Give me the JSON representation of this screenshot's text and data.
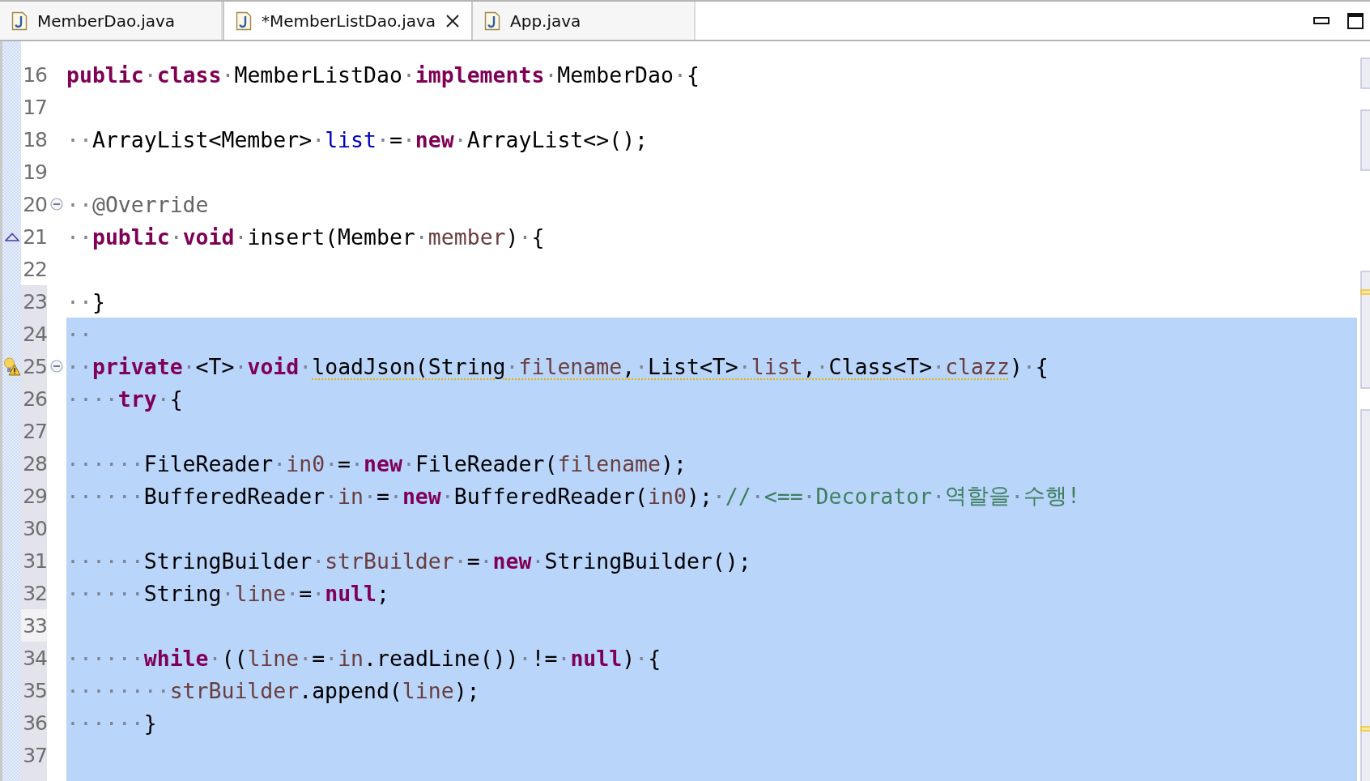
{
  "tabs": [
    {
      "label": "MemberDao.java",
      "selected": false,
      "close_button": false
    },
    {
      "label": "*MemberListDao.java",
      "selected": true,
      "close_button": true
    },
    {
      "label": "App.java",
      "selected": false,
      "close_button": false
    }
  ],
  "lines": [
    {
      "number": "16",
      "selected": false,
      "in_selection": false,
      "current": false,
      "fold": false,
      "tokens": [
        {
          "kind": "kw",
          "s": "public"
        },
        {
          "kind": "ws",
          "s": "·"
        },
        {
          "kind": "kw",
          "s": "class"
        },
        {
          "kind": "ws",
          "s": "·"
        },
        {
          "kind": "plain",
          "s": "MemberListDao"
        },
        {
          "kind": "ws",
          "s": "·"
        },
        {
          "kind": "kw",
          "s": "implements"
        },
        {
          "kind": "ws",
          "s": "·"
        },
        {
          "kind": "plain",
          "s": "MemberDao"
        },
        {
          "kind": "ws",
          "s": "·"
        },
        {
          "kind": "plain",
          "s": "{"
        }
      ]
    },
    {
      "number": "17",
      "selected": false,
      "in_selection": false,
      "current": false,
      "fold": false
    },
    {
      "number": "18",
      "selected": false,
      "in_selection": false,
      "current": false,
      "fold": false,
      "tokens": [
        {
          "kind": "ws",
          "s": "··"
        },
        {
          "kind": "plain",
          "s": "ArrayList<Member>"
        },
        {
          "kind": "ws",
          "s": "·"
        },
        {
          "kind": "field",
          "s": "list"
        },
        {
          "kind": "ws",
          "s": "·"
        },
        {
          "kind": "plain",
          "s": "="
        },
        {
          "kind": "ws",
          "s": "·"
        },
        {
          "kind": "kw",
          "s": "new"
        },
        {
          "kind": "ws",
          "s": "·"
        },
        {
          "kind": "plain",
          "s": "ArrayList<>();"
        }
      ]
    },
    {
      "number": "19",
      "selected": false,
      "in_selection": false,
      "current": false,
      "fold": false
    },
    {
      "number": "20",
      "selected": false,
      "in_selection": false,
      "current": false,
      "fold": true,
      "tokens": [
        {
          "kind": "ws",
          "s": "··"
        },
        {
          "kind": "ann",
          "s": "@Override"
        }
      ]
    },
    {
      "number": "21",
      "selected": false,
      "in_selection": false,
      "current": false,
      "fold": false,
      "marker": {
        "kind": "override"
      },
      "tokens": [
        {
          "kind": "ws",
          "s": "··"
        },
        {
          "kind": "kw",
          "s": "public"
        },
        {
          "kind": "ws",
          "s": "·"
        },
        {
          "kind": "kw",
          "s": "void"
        },
        {
          "kind": "ws",
          "s": "·"
        },
        {
          "kind": "plain",
          "s": "insert(Member"
        },
        {
          "kind": "ws",
          "s": "·"
        },
        {
          "kind": "var",
          "s": "member"
        },
        {
          "kind": "plain",
          "s": ")"
        },
        {
          "kind": "ws",
          "s": "·"
        },
        {
          "kind": "plain",
          "s": "{"
        }
      ]
    },
    {
      "number": "22",
      "selected": false,
      "in_selection": false,
      "current": false,
      "fold": false
    },
    {
      "number": "23",
      "selected": false,
      "in_selection": true,
      "current": false,
      "fold": false,
      "tokens": [
        {
          "kind": "ws",
          "s": "··"
        },
        {
          "kind": "plain",
          "s": "}"
        }
      ]
    },
    {
      "number": "24",
      "selected": true,
      "in_selection": true,
      "current": false,
      "fold": false,
      "tokens": [
        {
          "kind": "ws",
          "s": "··"
        }
      ]
    },
    {
      "number": "25",
      "selected": true,
      "in_selection": true,
      "current": false,
      "fold": true,
      "marker": {
        "kind": "warning"
      },
      "tokens": [
        {
          "kind": "ws",
          "s": "··"
        },
        {
          "kind": "kw",
          "s": "private"
        },
        {
          "kind": "ws",
          "s": "·"
        },
        {
          "kind": "plain",
          "s": "<T>"
        },
        {
          "kind": "ws",
          "s": "·"
        },
        {
          "kind": "kw",
          "s": "void"
        },
        {
          "kind": "ws",
          "s": "·"
        },
        {
          "kind": "warning",
          "tokens": [
            {
              "kind": "plain",
              "s": "loadJson(String"
            },
            {
              "kind": "ws",
              "s": "·"
            },
            {
              "kind": "var",
              "s": "filename"
            },
            {
              "kind": "plain",
              "s": ","
            },
            {
              "kind": "ws",
              "s": "·"
            },
            {
              "kind": "plain",
              "s": "List<T>"
            },
            {
              "kind": "ws",
              "s": "·"
            },
            {
              "kind": "var",
              "s": "list"
            },
            {
              "kind": "plain",
              "s": ","
            },
            {
              "kind": "ws",
              "s": "·"
            },
            {
              "kind": "plain",
              "s": "Class<T>"
            },
            {
              "kind": "ws",
              "s": "·"
            },
            {
              "kind": "var",
              "s": "clazz"
            }
          ]
        },
        {
          "kind": "plain",
          "s": ")"
        },
        {
          "kind": "ws",
          "s": "·"
        },
        {
          "kind": "plain",
          "s": "{"
        }
      ]
    },
    {
      "number": "26",
      "selected": true,
      "in_selection": true,
      "current": false,
      "fold": false,
      "tokens": [
        {
          "kind": "ws",
          "s": "····"
        },
        {
          "kind": "kw",
          "s": "try"
        },
        {
          "kind": "ws",
          "s": "·"
        },
        {
          "kind": "plain",
          "s": "{"
        }
      ]
    },
    {
      "number": "27",
      "selected": true,
      "in_selection": true,
      "current": false,
      "fold": false
    },
    {
      "number": "28",
      "selected": true,
      "in_selection": true,
      "current": false,
      "fold": false,
      "tokens": [
        {
          "kind": "ws",
          "s": "······"
        },
        {
          "kind": "plain",
          "s": "FileReader"
        },
        {
          "kind": "ws",
          "s": "·"
        },
        {
          "kind": "var",
          "s": "in0"
        },
        {
          "kind": "ws",
          "s": "·"
        },
        {
          "kind": "plain",
          "s": "="
        },
        {
          "kind": "ws",
          "s": "·"
        },
        {
          "kind": "kw",
          "s": "new"
        },
        {
          "kind": "ws",
          "s": "·"
        },
        {
          "kind": "plain",
          "s": "FileReader("
        },
        {
          "kind": "var",
          "s": "filename"
        },
        {
          "kind": "plain",
          "s": ");"
        }
      ]
    },
    {
      "number": "29",
      "selected": true,
      "in_selection": true,
      "current": false,
      "fold": false,
      "tokens": [
        {
          "kind": "ws",
          "s": "······"
        },
        {
          "kind": "plain",
          "s": "BufferedReader"
        },
        {
          "kind": "ws",
          "s": "·"
        },
        {
          "kind": "var",
          "s": "in"
        },
        {
          "kind": "ws",
          "s": "·"
        },
        {
          "kind": "plain",
          "s": "="
        },
        {
          "kind": "ws",
          "s": "·"
        },
        {
          "kind": "kw",
          "s": "new"
        },
        {
          "kind": "ws",
          "s": "·"
        },
        {
          "kind": "plain",
          "s": "BufferedReader("
        },
        {
          "kind": "var",
          "s": "in0"
        },
        {
          "kind": "plain",
          "s": ");"
        },
        {
          "kind": "ws",
          "s": "·"
        },
        {
          "kind": "comment",
          "s": "//"
        },
        {
          "kind": "ws",
          "s": "·"
        },
        {
          "kind": "comment",
          "s": "<=="
        },
        {
          "kind": "ws",
          "s": "·"
        },
        {
          "kind": "comment",
          "s": "Decorator"
        },
        {
          "kind": "ws",
          "s": "·"
        },
        {
          "kind": "comment",
          "s": "역할을"
        },
        {
          "kind": "ws",
          "s": "·"
        },
        {
          "kind": "comment",
          "s": "수행!"
        }
      ]
    },
    {
      "number": "30",
      "selected": true,
      "in_selection": true,
      "current": false,
      "fold": false
    },
    {
      "number": "31",
      "selected": true,
      "in_selection": true,
      "current": false,
      "fold": false,
      "tokens": [
        {
          "kind": "ws",
          "s": "······"
        },
        {
          "kind": "plain",
          "s": "StringBuilder"
        },
        {
          "kind": "ws",
          "s": "·"
        },
        {
          "kind": "var",
          "s": "strBuilder"
        },
        {
          "kind": "ws",
          "s": "·"
        },
        {
          "kind": "plain",
          "s": "="
        },
        {
          "kind": "ws",
          "s": "·"
        },
        {
          "kind": "kw",
          "s": "new"
        },
        {
          "kind": "ws",
          "s": "·"
        },
        {
          "kind": "plain",
          "s": "StringBuilder();"
        }
      ]
    },
    {
      "number": "32",
      "selected": true,
      "in_selection": true,
      "current": false,
      "fold": false,
      "tokens": [
        {
          "kind": "ws",
          "s": "······"
        },
        {
          "kind": "plain",
          "s": "String"
        },
        {
          "kind": "ws",
          "s": "·"
        },
        {
          "kind": "var",
          "s": "line"
        },
        {
          "kind": "ws",
          "s": "·"
        },
        {
          "kind": "plain",
          "s": "="
        },
        {
          "kind": "ws",
          "s": "·"
        },
        {
          "kind": "kw",
          "s": "null"
        },
        {
          "kind": "plain",
          "s": ";"
        }
      ]
    },
    {
      "number": "33",
      "selected": true,
      "in_selection": true,
      "current": true,
      "fold": false
    },
    {
      "number": "34",
      "selected": true,
      "in_selection": true,
      "current": false,
      "fold": false,
      "tokens": [
        {
          "kind": "ws",
          "s": "······"
        },
        {
          "kind": "kw",
          "s": "while"
        },
        {
          "kind": "ws",
          "s": "·"
        },
        {
          "kind": "plain",
          "s": "(("
        },
        {
          "kind": "var",
          "s": "line"
        },
        {
          "kind": "ws",
          "s": "·"
        },
        {
          "kind": "plain",
          "s": "="
        },
        {
          "kind": "ws",
          "s": "·"
        },
        {
          "kind": "var",
          "s": "in"
        },
        {
          "kind": "plain",
          "s": ".readLine())"
        },
        {
          "kind": "ws",
          "s": "·"
        },
        {
          "kind": "plain",
          "s": "!="
        },
        {
          "kind": "ws",
          "s": "·"
        },
        {
          "kind": "kw",
          "s": "null"
        },
        {
          "kind": "plain",
          "s": ")"
        },
        {
          "kind": "ws",
          "s": "·"
        },
        {
          "kind": "plain",
          "s": "{"
        }
      ]
    },
    {
      "number": "35",
      "selected": true,
      "in_selection": true,
      "current": false,
      "fold": false,
      "tokens": [
        {
          "kind": "ws",
          "s": "········"
        },
        {
          "kind": "var",
          "s": "strBuilder"
        },
        {
          "kind": "plain",
          "s": ".append("
        },
        {
          "kind": "var",
          "s": "line"
        },
        {
          "kind": "plain",
          "s": ");"
        }
      ]
    },
    {
      "number": "36",
      "selected": true,
      "in_selection": true,
      "current": false,
      "fold": false,
      "tokens": [
        {
          "kind": "ws",
          "s": "······"
        },
        {
          "kind": "plain",
          "s": "}"
        }
      ]
    },
    {
      "number": "37",
      "selected": true,
      "in_selection": true,
      "current": false,
      "fold": false
    }
  ]
}
